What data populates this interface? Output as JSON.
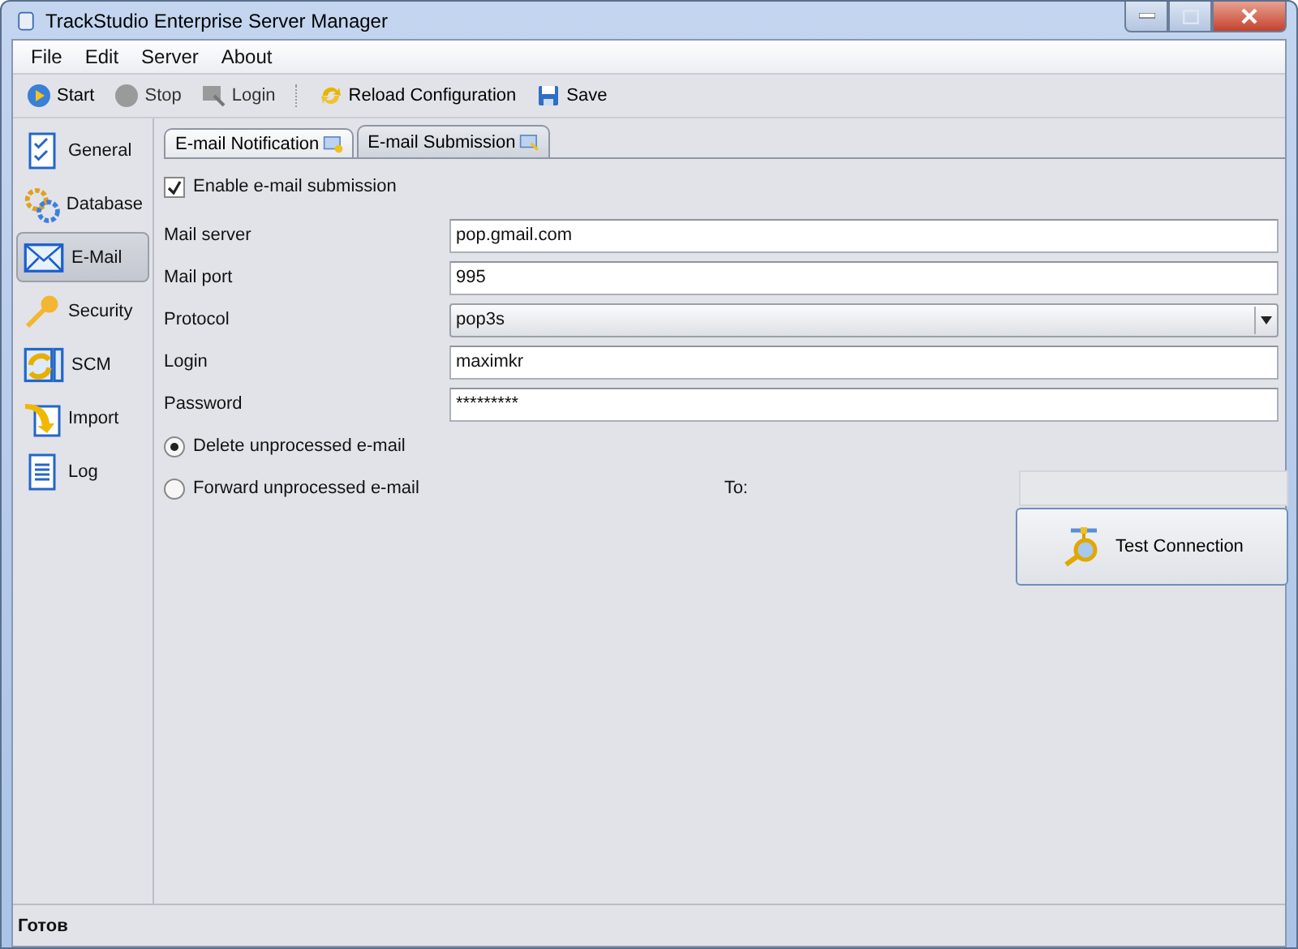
{
  "window": {
    "title": "TrackStudio Enterprise Server Manager"
  },
  "menu": [
    "File",
    "Edit",
    "Server",
    "About"
  ],
  "toolbar": [
    {
      "label": "Start",
      "disabled": false
    },
    {
      "label": "Stop",
      "disabled": true
    },
    {
      "label": "Login",
      "disabled": true
    },
    {
      "label": "Reload Configuration",
      "disabled": false
    },
    {
      "label": "Save",
      "disabled": false
    }
  ],
  "sidebar": {
    "items": [
      {
        "label": "General",
        "selected": false
      },
      {
        "label": "Database",
        "selected": false
      },
      {
        "label": "E-Mail",
        "selected": true
      },
      {
        "label": "Security",
        "selected": false
      },
      {
        "label": "SCM",
        "selected": false
      },
      {
        "label": "Import",
        "selected": false
      },
      {
        "label": "Log",
        "selected": false
      }
    ]
  },
  "tabs": [
    {
      "label": "E-mail Notification",
      "selected": false
    },
    {
      "label": "E-mail Submission",
      "selected": true
    }
  ],
  "enable_checkbox": {
    "label": "Enable e-mail submission",
    "checked": true
  },
  "fields": [
    {
      "label": "Mail server",
      "kind": "text",
      "value": "pop.gmail.com"
    },
    {
      "label": "Mail port",
      "kind": "text",
      "value": "995"
    },
    {
      "label": "Protocol",
      "kind": "select",
      "value": "pop3s"
    },
    {
      "label": "Login",
      "kind": "text",
      "value": "maximkr"
    },
    {
      "label": "Password",
      "kind": "text",
      "value": "*********"
    }
  ],
  "radios": [
    {
      "label": "Delete unprocessed e-mail",
      "selected": true
    },
    {
      "label": "Forward unprocessed e-mail",
      "selected": false
    }
  ],
  "forward_to": {
    "label": "To:",
    "disabled": true
  },
  "test_button": {
    "label": "Test Connection"
  },
  "status_bar": {
    "text": "Готов"
  }
}
